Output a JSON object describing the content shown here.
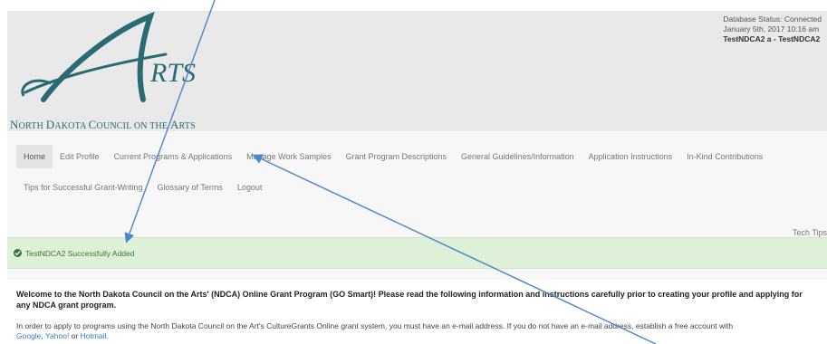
{
  "logo": {
    "letter": "A",
    "rest": "RTS",
    "subtitle_parts": [
      "N",
      "ORTH ",
      "D",
      "AKOTA ",
      "C",
      "OUNCIL ON THE ",
      "A",
      "RTS"
    ]
  },
  "status": {
    "line1": "Database Status: Connected",
    "line2": "January 5th, 2017 10:16 am",
    "line3": "TestNDCA2 a - TestNDCA2"
  },
  "nav": {
    "row1": [
      "Home",
      "Edit Profile",
      "Current Programs & Applications",
      "Manage Work Samples",
      "Grant Program Descriptions",
      "General Guidelines/Information",
      "Application Instructions",
      "In-Kind Contributions"
    ],
    "row2": [
      "Tips for Successful Grant-Writing",
      "Glossary of Terms",
      "Logout"
    ],
    "active": "Home",
    "tech_tips": "Tech Tips"
  },
  "alert": {
    "message": "TestNDCA2 Successfully Added"
  },
  "content": {
    "welcome": "Welcome to the North Dakota Council on the Arts' (NDCA) Online Grant Program (GO Smart)! Please read the following information and instructions carefully prior to creating your profile and applying for any NDCA grant program.",
    "info": "In order to apply to programs using the North Dakota Council on the Art's CultureGrants Online grant system, you must have an e-mail address. If you do not have an e-mail address, establish a free account with",
    "links": [
      "Google",
      "Yahoo!",
      "Hotmail"
    ],
    "sep1": ", ",
    "sep2": " or ",
    "end": "."
  },
  "colors": {
    "logo_teal": "#2a6a73",
    "alert_bg": "#dff0d8",
    "alert_text": "#3c763d",
    "arrow": "#4a86c8"
  }
}
